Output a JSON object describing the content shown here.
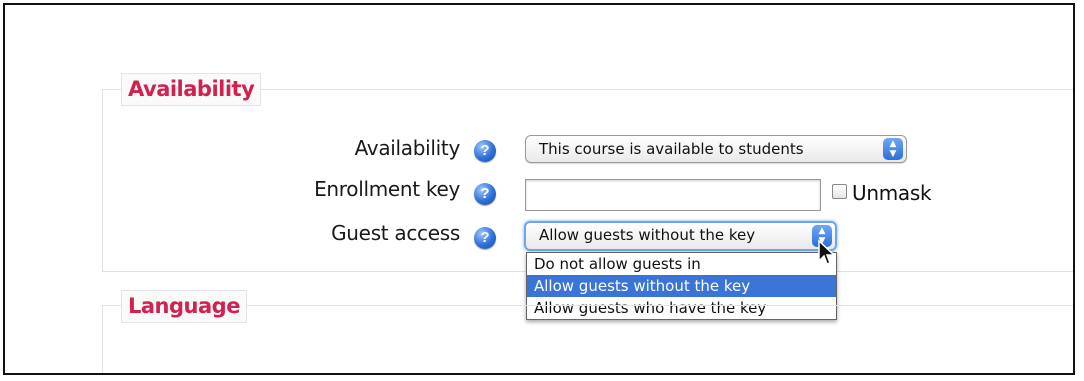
{
  "sections": {
    "availability_legend": "Availability",
    "language_legend": "Language"
  },
  "fields": {
    "availability": {
      "label": "Availability",
      "value": "This course is available to students"
    },
    "enrollment_key": {
      "label": "Enrollment key",
      "value": "",
      "unmask_label": "Unmask"
    },
    "guest_access": {
      "label": "Guest access",
      "value": "Allow guests without the key",
      "options": [
        "Do not allow guests in",
        "Allow guests without the key",
        "Allow guests who have the key"
      ],
      "selected_index": 1
    }
  },
  "help_icon_glyph": "?",
  "stepper_glyph": "▲▼",
  "colors": {
    "legend_text": "#d2204f",
    "selection": "#3a74d7",
    "help_icon": "#2f6fd6"
  }
}
